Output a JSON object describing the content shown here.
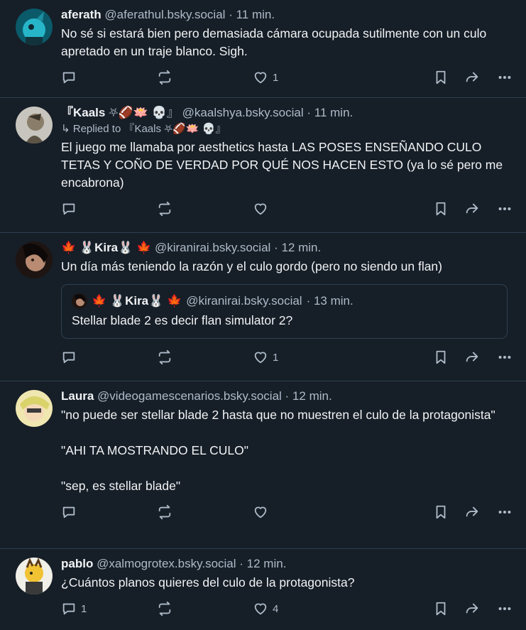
{
  "colors": {
    "background": "#161e27",
    "text": "#f1f3f5",
    "muted": "#aebbc9",
    "border": "#2e4052"
  },
  "posts": [
    {
      "name": "aferath",
      "handle": "@aferathul.bsky.social",
      "time": "· 11 min.",
      "body": "No sé si estará bien pero demasiada cámara ocupada sutilmente con un culo apretado en un traje blanco. Sigh.",
      "replies": "",
      "reposts": "",
      "likes": "1"
    },
    {
      "name": "『Kaals",
      "name_emoji": "⛧🏈🪷 💀』",
      "handle": "@kaalshya.bsky.social",
      "time": "· 11 min.",
      "reply_prefix": "↳ Replied to",
      "reply_to": "『Kaals ⛧🏈🪷 💀』",
      "body": "El juego me llamaba por aesthetics hasta LAS POSES ENSEÑANDO CULO TETAS Y COÑO DE VERDAD POR QUÉ NOS HACEN ESTO (ya lo sé pero me encabrona)",
      "replies": "",
      "reposts": "",
      "likes": ""
    },
    {
      "name_emoji_pre": "🍁 🐰",
      "name": "Kira",
      "name_emoji": "🐰 🍁",
      "handle": "@kiranirai.bsky.social",
      "time": "· 12 min.",
      "body": "Un día más teniendo la razón y el culo gordo (pero no siendo un flan)",
      "quote": {
        "name_emoji_pre": "🍁 🐰",
        "name": "Kira",
        "name_emoji": "🐰 🍁",
        "handle": "@kiranirai.bsky.social",
        "time": "· 13 min.",
        "body": "Stellar blade 2 es decir flan simulator 2?"
      },
      "replies": "",
      "reposts": "",
      "likes": "1"
    },
    {
      "name": "Laura",
      "handle": "@videogamescenarios.bsky.social",
      "time": "· 12 min.",
      "body": "\"no puede ser stellar blade 2 hasta que no muestren el culo de la protagonista\"\n\n\"AHI TA MOSTRANDO EL CULO\"\n\n\"sep, es stellar blade\"",
      "replies": "",
      "reposts": "",
      "likes": ""
    },
    {
      "name": "pablo",
      "handle": "@xalmogrotex.bsky.social",
      "time": "· 12 min.",
      "body": "¿Cuántos planos quieres del culo de la protagonista?",
      "replies": "1",
      "reposts": "",
      "likes": "4"
    }
  ]
}
